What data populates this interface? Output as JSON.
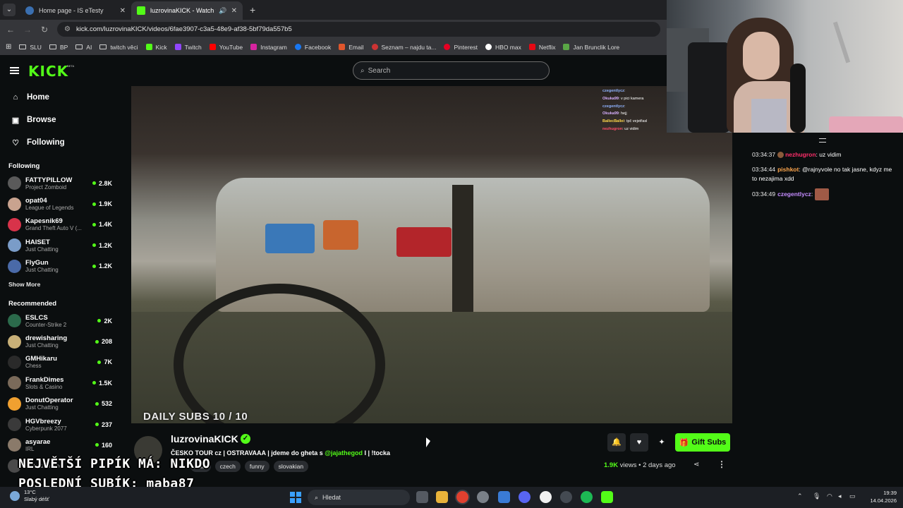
{
  "browser": {
    "tabs": [
      {
        "title": "Home page - IS eTesty"
      },
      {
        "title": "luzrovinaKICK - Watch the V"
      }
    ],
    "url": "kick.com/luzrovinaKICK/videos/6fae3907-c3a5-48e9-af38-5bf79da557b5",
    "bookmarks": [
      "SLU",
      "BP",
      "AI",
      "twitch věci",
      "Kick",
      "Twitch",
      "YouTube",
      "Instagram",
      "Facebook",
      "Email",
      "Seznam – najdu ta...",
      "Pinterest",
      "HBO max",
      "Netflix",
      "Jan Brunclik Lore"
    ]
  },
  "header": {
    "logo": "KICK",
    "logo_badge": "BETA",
    "search_placeholder": "Search"
  },
  "sidebar": {
    "nav": [
      {
        "label": "Home",
        "icon": "home-icon"
      },
      {
        "label": "Browse",
        "icon": "browse-icon"
      },
      {
        "label": "Following",
        "icon": "heart-icon"
      }
    ],
    "following_title": "Following",
    "following": [
      {
        "name": "FATTYPILLOW",
        "category": "Project Zomboid",
        "viewers": "2.8K"
      },
      {
        "name": "opat04",
        "category": "League of Legends",
        "viewers": "1.9K"
      },
      {
        "name": "Kapesnik69",
        "category": "Grand Theft Auto V (...",
        "viewers": "1.4K"
      },
      {
        "name": "HAISET",
        "category": "Just Chatting",
        "viewers": "1.2K"
      },
      {
        "name": "FlyGun",
        "category": "Just Chatting",
        "viewers": "1.2K"
      }
    ],
    "show_more": "Show More",
    "recommended_title": "Recommended",
    "recommended": [
      {
        "name": "ESLCS",
        "category": "Counter-Strike 2",
        "viewers": "2K"
      },
      {
        "name": "drewisharing",
        "category": "Just Chatting",
        "viewers": "208"
      },
      {
        "name": "GMHikaru",
        "category": "Chess",
        "viewers": "7K"
      },
      {
        "name": "FrankDimes",
        "category": "Slots & Casino",
        "viewers": "1.5K"
      },
      {
        "name": "DonutOperator",
        "category": "Just Chatting",
        "viewers": "532"
      },
      {
        "name": "HGVbreezy",
        "category": "Cyberpunk 2077",
        "viewers": "237"
      },
      {
        "name": "asyarae",
        "category": "IRL",
        "viewers": "160"
      },
      {
        "name": "",
        "category": "Slots & Casino",
        "viewers": ""
      }
    ]
  },
  "video": {
    "overlay_subs": "DAILY SUBS 10 / 10",
    "overlay_chat": [
      {
        "user": "czegentlycz",
        "text": ":"
      },
      {
        "user": "Okuka99",
        "text": ": v pici kamera"
      },
      {
        "user": "czegentlycz",
        "text": ":"
      },
      {
        "user": "Okuka99",
        "text": ": hejj"
      },
      {
        "user": "BallecBallei",
        "text": ": tpč vejetřasl"
      },
      {
        "user": "nezhugron",
        "text": ": uz vidim"
      }
    ]
  },
  "chat": {
    "messages": [
      {
        "time": "03:34:37",
        "user": "nezhugron",
        "user_color": "#ff2e6a",
        "text": ": uz vidim",
        "badge": true
      },
      {
        "time": "03:34:44",
        "user": "pishkot",
        "user_color": "#ffa64d",
        "text": ": @rajnyvole no tak jasne, kdyz me to nezajima xdd",
        "badge": false
      },
      {
        "time": "03:34:49",
        "user": "czegentlycz",
        "user_color": "#c58cff",
        "text": ":",
        "badge": false,
        "emote": true
      }
    ]
  },
  "stream": {
    "channel": "luzrovinaKICK",
    "title_pre": "ČESKO TOUR cz | OSTRAVAAA | jdeme do gheta s ",
    "title_mention": "@jajathegod",
    "title_post": " I  | !tocka",
    "tags": [
      "chill",
      "czech",
      "funny",
      "slovakian"
    ],
    "views": "1.9K",
    "views_label": "views",
    "separator": "•",
    "age": "2 days ago",
    "gift_label": "Gift Subs"
  },
  "overlay_text": {
    "line1": "NEJVĚTŠÍ PIPÍK MÁ: NIKDO",
    "line2": "POSLEDNÍ SUBÍK: maba87"
  },
  "taskbar": {
    "temp": "13°C",
    "weather": "Slabý déšť",
    "search": "Hledat",
    "time": "19:39",
    "date": "14.04.2026"
  },
  "colors": {
    "kick_green": "#53fc18",
    "background": "#0b0e0f"
  }
}
